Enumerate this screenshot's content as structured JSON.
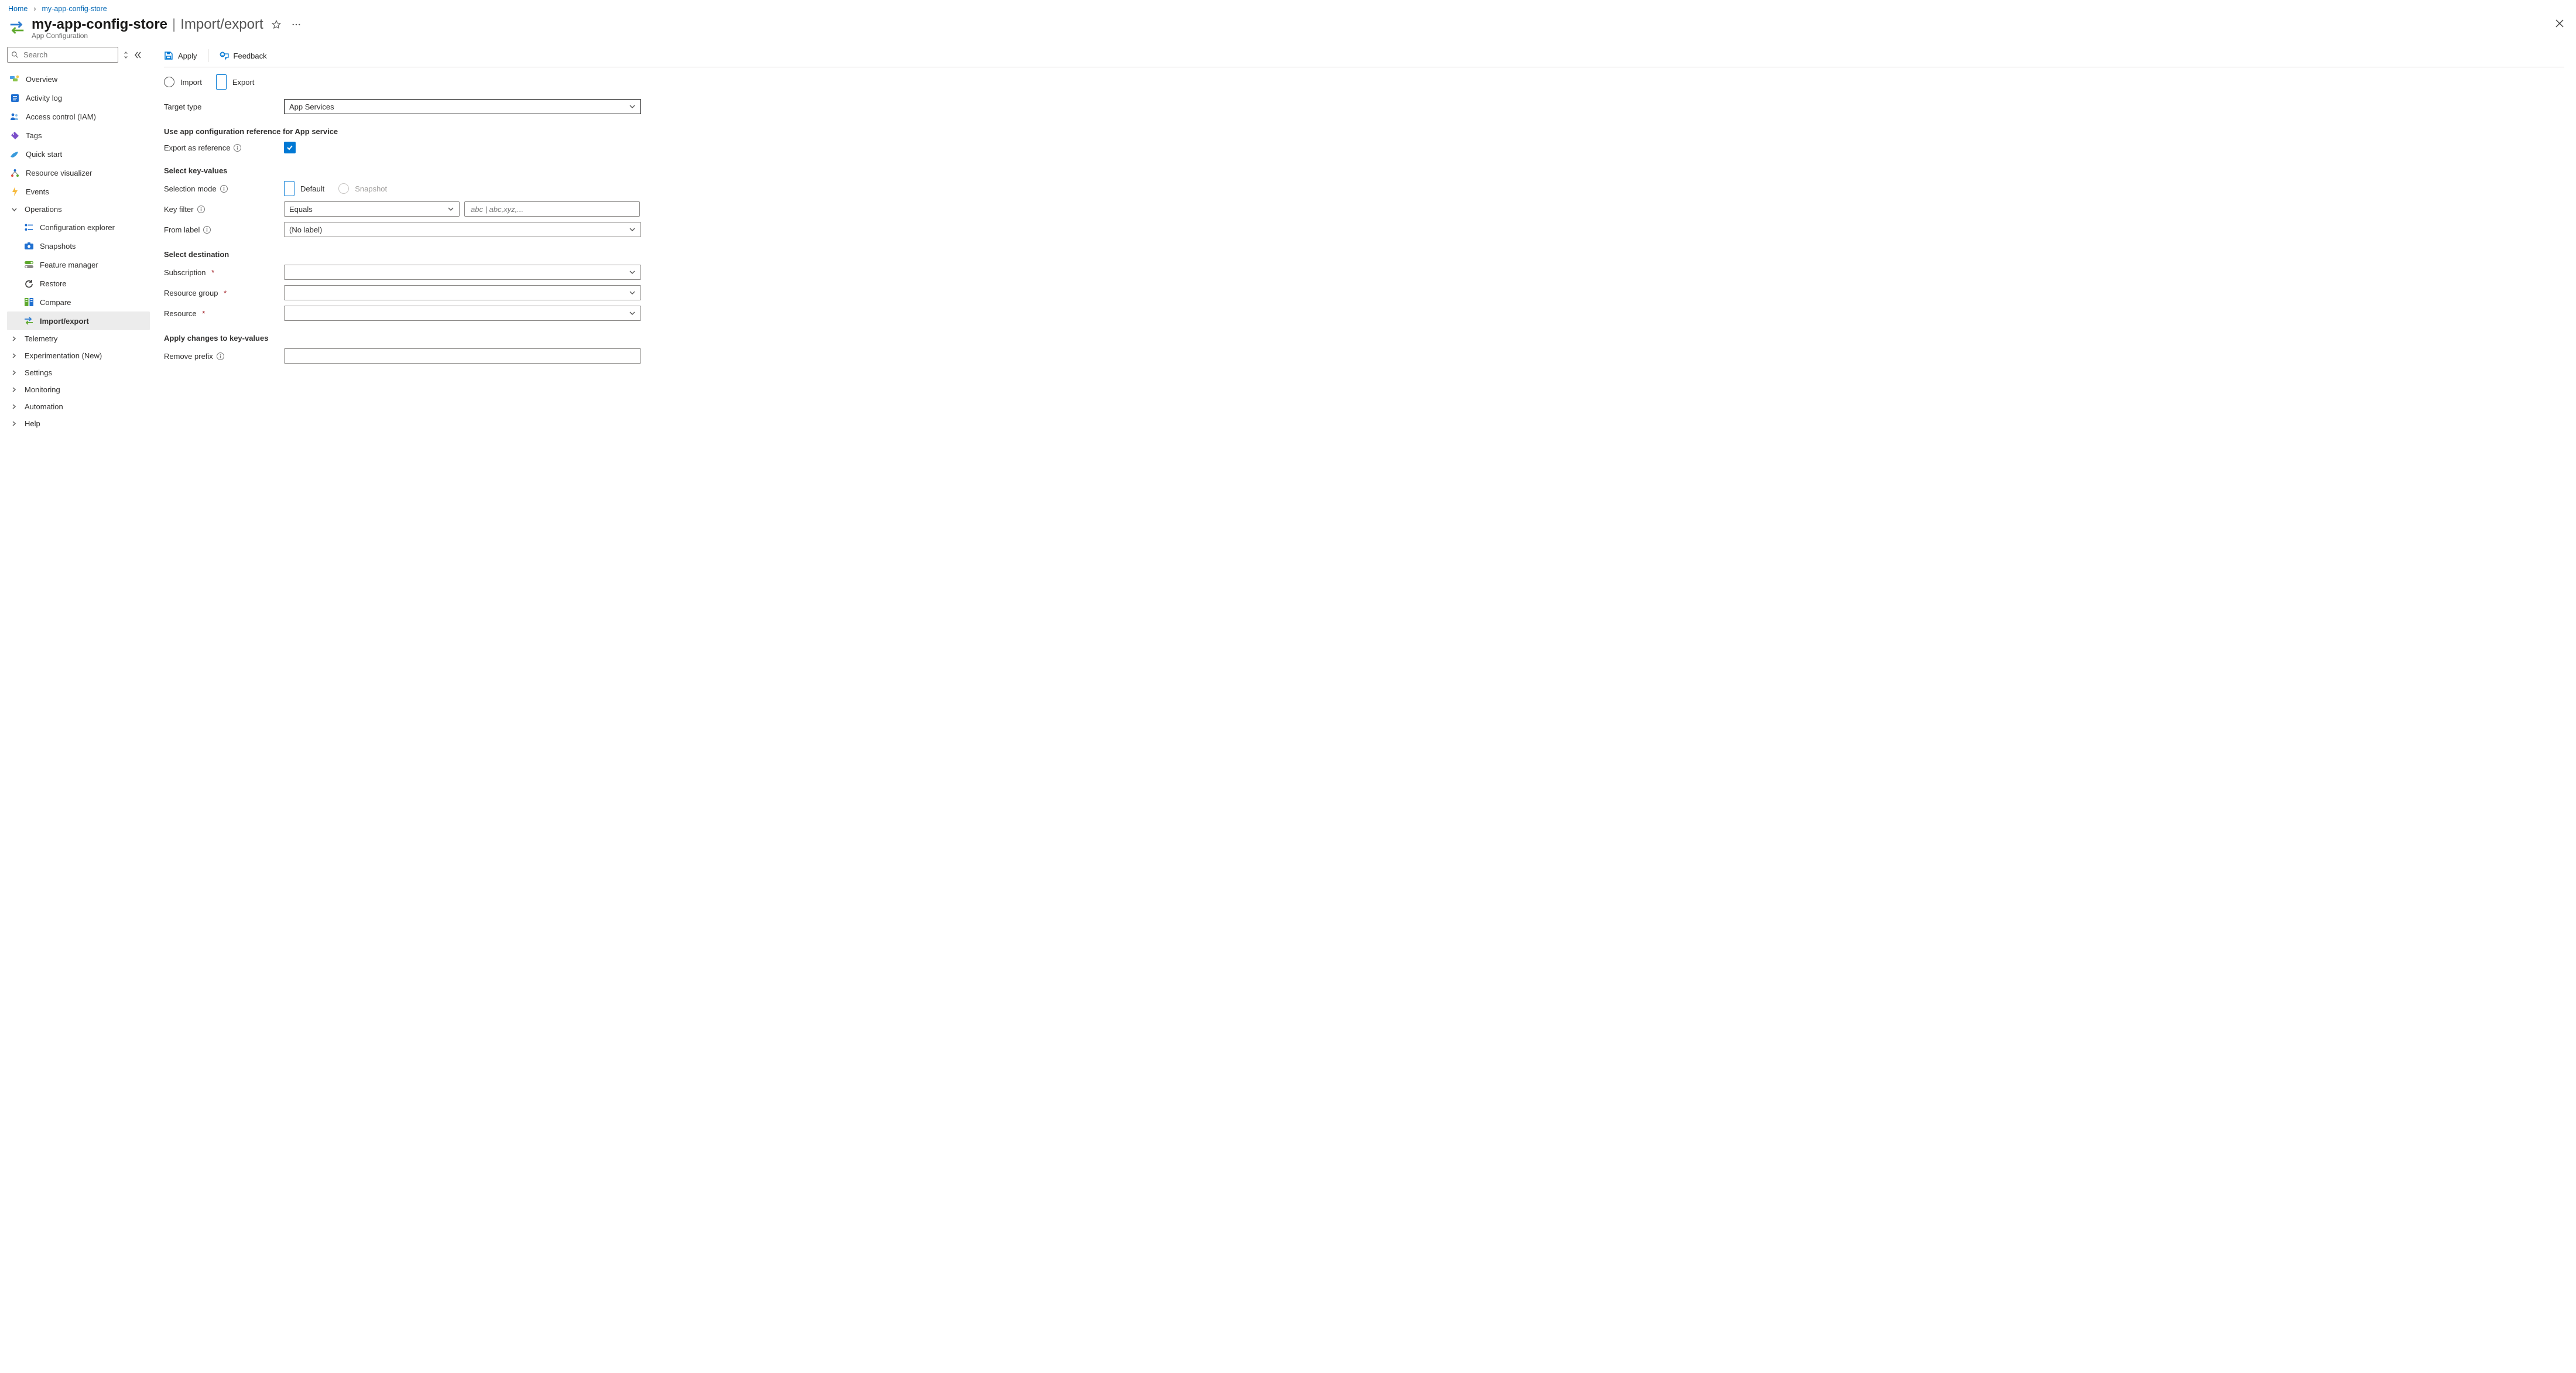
{
  "breadcrumbs": {
    "home": "Home",
    "store": "my-app-config-store"
  },
  "title": {
    "store_name": "my-app-config-store",
    "section": "Import/export",
    "subtitle": "App Configuration"
  },
  "sidebar": {
    "search_placeholder": "Search",
    "items": {
      "overview": "Overview",
      "activity_log": "Activity log",
      "access_control": "Access control (IAM)",
      "tags": "Tags",
      "quick_start": "Quick start",
      "resource_visualizer": "Resource visualizer",
      "events": "Events",
      "operations": "Operations",
      "configuration_explorer": "Configuration explorer",
      "snapshots": "Snapshots",
      "feature_manager": "Feature manager",
      "restore": "Restore",
      "compare": "Compare",
      "import_export": "Import/export",
      "telemetry": "Telemetry",
      "experimentation": "Experimentation (New)",
      "settings": "Settings",
      "monitoring": "Monitoring",
      "automation": "Automation",
      "help": "Help"
    }
  },
  "commands": {
    "apply": "Apply",
    "feedback": "Feedback"
  },
  "form": {
    "import_label": "Import",
    "export_label": "Export",
    "target_type_label": "Target type",
    "target_type_value": "App Services",
    "section_reference": "Use app configuration reference for App service",
    "export_as_reference_label": "Export as reference",
    "section_select_kv": "Select key-values",
    "selection_mode_label": "Selection mode",
    "selection_mode_default": "Default",
    "selection_mode_snapshot": "Snapshot",
    "key_filter_label": "Key filter",
    "key_filter_value": "Equals",
    "key_filter_placeholder": "abc | abc,xyz,...",
    "from_label_label": "From label",
    "from_label_value": "(No label)",
    "section_destination": "Select destination",
    "subscription_label": "Subscription",
    "resource_group_label": "Resource group",
    "resource_label": "Resource",
    "section_apply_changes": "Apply changes to key-values",
    "remove_prefix_label": "Remove prefix"
  }
}
